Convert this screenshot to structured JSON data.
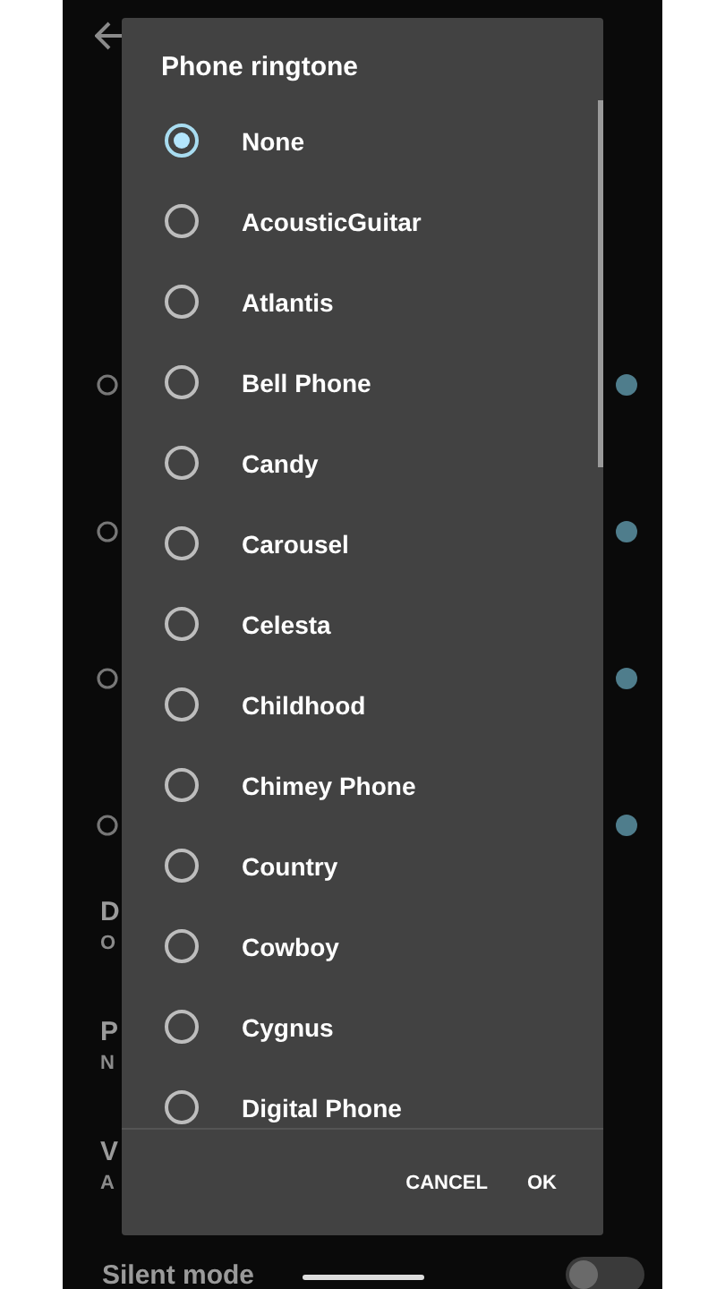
{
  "background": {
    "settings": [
      {
        "title": "D",
        "subtitle": "O"
      },
      {
        "title": "P",
        "subtitle": "N"
      },
      {
        "title": "V",
        "subtitle": "A"
      }
    ],
    "silent_mode": {
      "label": "Silent mode",
      "on": false
    }
  },
  "dialog": {
    "title": "Phone ringtone",
    "options": [
      {
        "label": "None",
        "selected": true
      },
      {
        "label": "AcousticGuitar",
        "selected": false
      },
      {
        "label": "Atlantis",
        "selected": false
      },
      {
        "label": "Bell Phone",
        "selected": false
      },
      {
        "label": "Candy",
        "selected": false
      },
      {
        "label": "Carousel",
        "selected": false
      },
      {
        "label": "Celesta",
        "selected": false
      },
      {
        "label": "Childhood",
        "selected": false
      },
      {
        "label": "Chimey Phone",
        "selected": false
      },
      {
        "label": "Country",
        "selected": false
      },
      {
        "label": "Cowboy",
        "selected": false
      },
      {
        "label": "Cygnus",
        "selected": false
      },
      {
        "label": "Digital Phone",
        "selected": false
      }
    ],
    "buttons": [
      "CANCEL",
      "OK"
    ]
  }
}
